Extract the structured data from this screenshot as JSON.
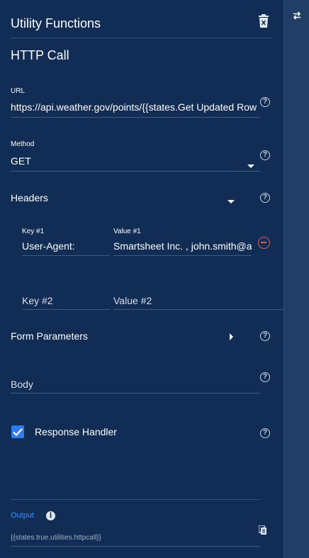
{
  "panel": {
    "title": "Utility Functions",
    "section_title": "HTTP Call"
  },
  "url": {
    "label": "URL",
    "value": "https://api.weather.gov/points/{{states.Get Updated Row"
  },
  "method": {
    "label": "Method",
    "value": "GET"
  },
  "headers": {
    "label": "Headers",
    "rows": [
      {
        "key_label": "Key #1",
        "value_label": "Value #1",
        "key": "User-Agent:",
        "value": "Smartsheet Inc. , john.smith@ac"
      }
    ],
    "new_key_placeholder": "Key #2",
    "new_value_placeholder": "Value #2"
  },
  "form_parameters": {
    "label": "Form Parameters"
  },
  "body": {
    "placeholder": "Body"
  },
  "response_handler": {
    "label": "Response Handler",
    "checked": true
  },
  "output": {
    "label": "Output",
    "value": "{{states.true.utilities.httpcall}}"
  },
  "icons": {
    "trash": "trash-icon",
    "help": "help-circle-icon",
    "caret_down": "caret-down-icon",
    "caret_right": "caret-right-icon",
    "remove": "remove-circle-icon",
    "check": "check-icon",
    "info": "info-icon",
    "copy": "copy-icon",
    "swap": "swap-arrows-icon"
  },
  "colors": {
    "background": "#112d55",
    "rail": "#213f66",
    "accent": "#2f7cf0",
    "output_label": "#3e8ff7",
    "remove": "#e05a4d"
  }
}
